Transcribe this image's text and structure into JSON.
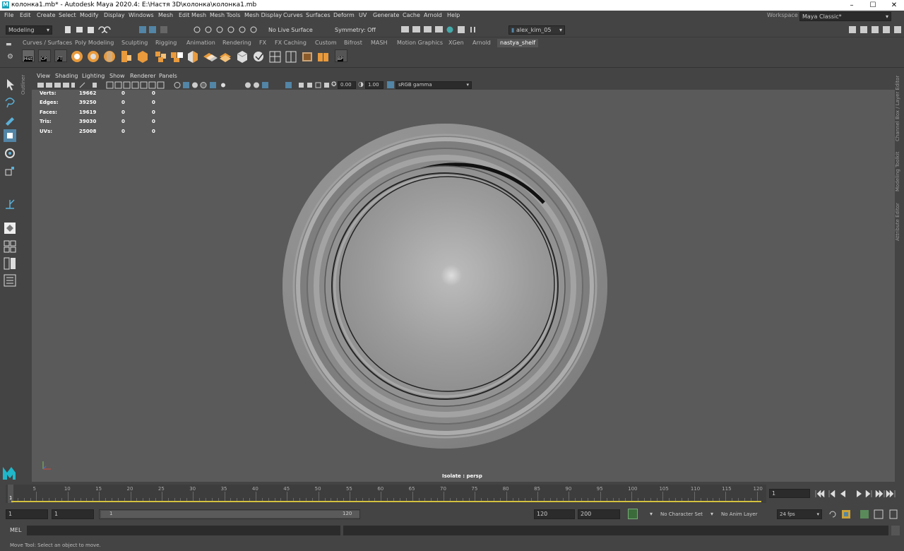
{
  "window": {
    "title": "колонка1.mb* - Autodesk Maya 2020.4: E:\\Настя 3D\\колонка\\колонка1.mb"
  },
  "menus": [
    "File",
    "Edit",
    "Create",
    "Select",
    "Modify",
    "Display",
    "Windows",
    "Mesh",
    "Edit Mesh",
    "Mesh Tools",
    "Mesh Display",
    "Curves",
    "Surfaces",
    "Deform",
    "UV",
    "Generate",
    "Cache",
    "Arnold",
    "Help"
  ],
  "workspace": {
    "label": "Workspace :",
    "value": "Maya Classic*"
  },
  "statusline": {
    "mode": "Modeling",
    "live_surface": "No Live Surface",
    "symmetry": "Symmetry: Off",
    "user": "alex_kim_05"
  },
  "shelf_tabs": [
    "Curves / Surfaces",
    "Poly Modeling",
    "Sculpting",
    "Rigging",
    "Animation",
    "Rendering",
    "FX",
    "FX Caching",
    "Custom",
    "Bifrost",
    "MASH",
    "Motion Graphics",
    "XGen",
    "Arnold",
    "nastya_shelf"
  ],
  "shelf_active": "nastya_shelf",
  "shelf_buttons": {
    "hist": "Hist",
    "cp": "CP",
    "ft": "FT",
    "bp": "BP"
  },
  "outliner_label": "Outliner",
  "viewport": {
    "menus": [
      "View",
      "Shading",
      "Lighting",
      "Show",
      "Renderer",
      "Panels"
    ],
    "exposure": "0.00",
    "gamma": "1.00",
    "color_space": "sRGB gamma",
    "camera_label": "Isolate : persp"
  },
  "hud_stats": [
    {
      "label": "Verts:",
      "v1": "19662",
      "v2": "0",
      "v3": "0"
    },
    {
      "label": "Edges:",
      "v1": "39250",
      "v2": "0",
      "v3": "0"
    },
    {
      "label": "Faces:",
      "v1": "19619",
      "v2": "0",
      "v3": "0"
    },
    {
      "label": "Tris:",
      "v1": "39030",
      "v2": "0",
      "v3": "0"
    },
    {
      "label": "UVs:",
      "v1": "25008",
      "v2": "0",
      "v3": "0"
    }
  ],
  "right_panels": [
    "Channel Box / Layer Editor",
    "Modeling Toolkit",
    "Attribute Editor"
  ],
  "timeline": {
    "ticks": [
      "5",
      "10",
      "15",
      "20",
      "25",
      "30",
      "35",
      "40",
      "45",
      "50",
      "55",
      "60",
      "65",
      "70",
      "75",
      "80",
      "85",
      "90",
      "95",
      "100",
      "105",
      "110",
      "115",
      "120"
    ],
    "start_marker": "1",
    "current_frame": "1"
  },
  "range": {
    "start": "1",
    "playback_start": "1",
    "slider_start": "1",
    "slider_end": "120",
    "playback_end": "120",
    "end": "200",
    "character_set": "No Character Set",
    "anim_layer": "No Anim Layer",
    "fps": "24 fps"
  },
  "cmdline": {
    "label": "MEL"
  },
  "helpline": {
    "text": "Move Tool: Select an object to move."
  },
  "colors": {
    "accent": "#5285a6",
    "viewport_bg": "#5a5a5a",
    "panel": "#444444"
  }
}
